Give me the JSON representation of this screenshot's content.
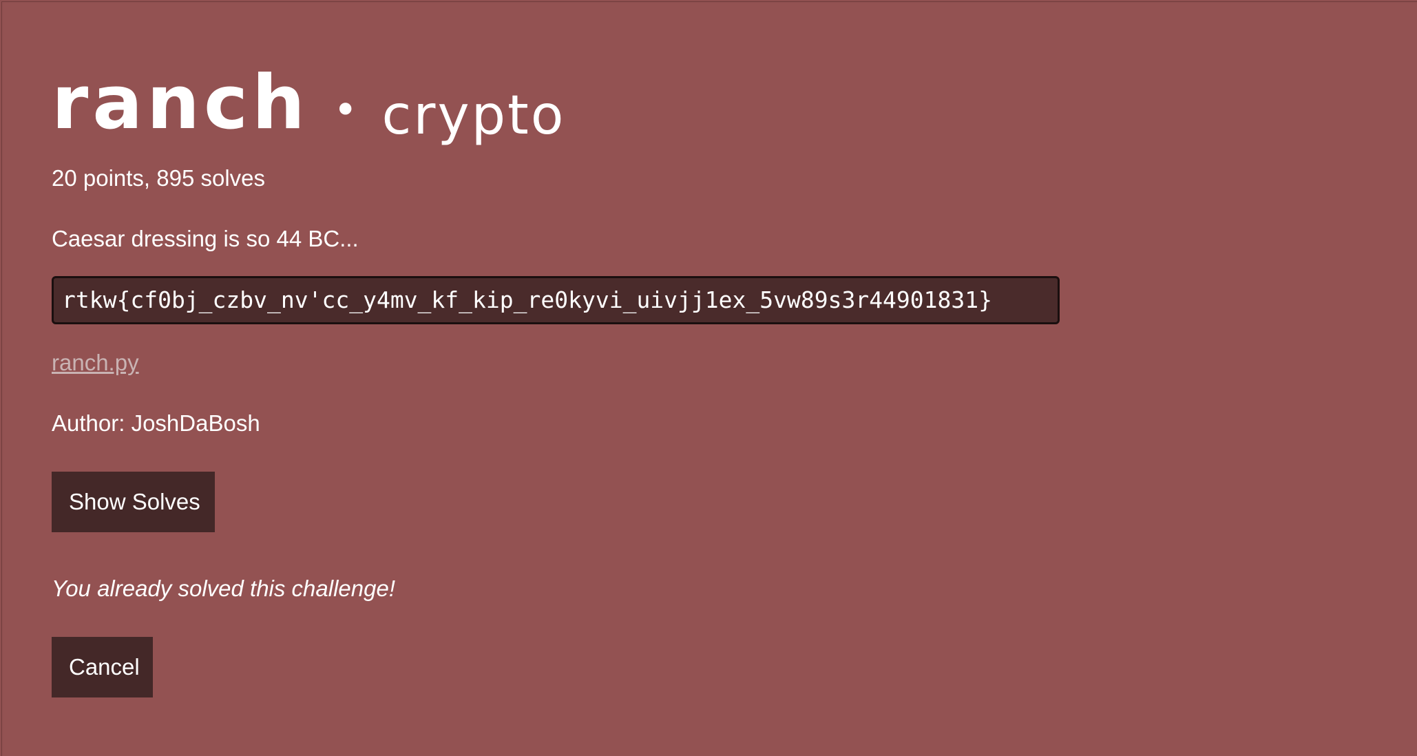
{
  "challenge": {
    "name": "ranch",
    "separator": "•",
    "category": "crypto",
    "meta": "20 points, 895 solves",
    "description": "Caesar dressing is so 44 BC...",
    "ciphertext": "rtkw{cf0bj_czbv_nv'cc_y4mv_kf_kip_re0kyvi_uivjj1ex_5vw89s3r44901831}",
    "attachment": "ranch.py",
    "author": "Author: JoshDaBosh",
    "status_message": "You already solved this challenge!"
  },
  "buttons": {
    "show_solves": "Show Solves",
    "cancel": "Cancel"
  },
  "colors": {
    "background": "#935252",
    "button": "#442828",
    "code_box": "#4a2b2b",
    "link": "#c9b3b3"
  }
}
